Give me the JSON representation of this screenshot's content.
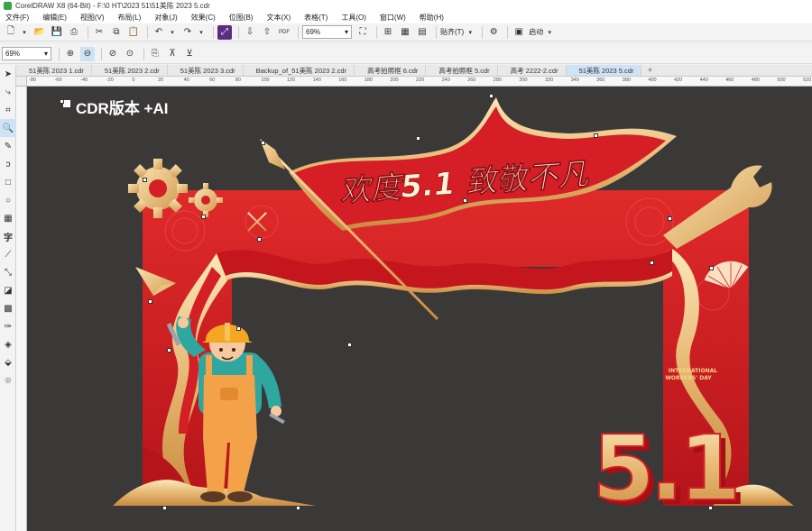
{
  "window": {
    "title": "CorelDRAW X8 (64-Bit) - F:\\0 HT\\2023 51\\51美陈 2023 5.cdr"
  },
  "menu": [
    "文件(F)",
    "编辑(E)",
    "视图(V)",
    "布局(L)",
    "对象(J)",
    "效果(C)",
    "位图(B)",
    "文本(X)",
    "表格(T)",
    "工具(O)",
    "窗口(W)",
    "帮助(H)"
  ],
  "toolbar": {
    "zoom_value": "69%",
    "snap_label": "贴齐(T)",
    "launch_label": "启动"
  },
  "toolbar2": {
    "zoom_value": "69%"
  },
  "tabs": [
    {
      "label": "51美陈 2023 1.cdr",
      "active": false
    },
    {
      "label": "51美陈 2023 2.cdr",
      "active": false
    },
    {
      "label": "51美陈 2023 3.cdr",
      "active": false
    },
    {
      "label": "Backup_of_51美陈 2023 2.cdr",
      "active": false
    },
    {
      "label": "高考拍照框 6.cdr",
      "active": false
    },
    {
      "label": "高考拍照框 5.cdr",
      "active": false
    },
    {
      "label": "高考 2222-2.cdr",
      "active": false
    },
    {
      "label": "51美陈 2023 5.cdr",
      "active": true
    }
  ],
  "ruler_ticks": [
    "-80",
    "-60",
    "-40",
    "-20",
    "0",
    "20",
    "40",
    "60",
    "80",
    "100",
    "120",
    "140",
    "160",
    "180",
    "200",
    "220",
    "240",
    "260",
    "280",
    "300",
    "320",
    "340",
    "360",
    "380",
    "400",
    "420",
    "440",
    "460",
    "480",
    "500",
    "520"
  ],
  "canvas": {
    "label": "CDR版本 +AI",
    "design": {
      "headline": "欢度5.1 致敬不凡",
      "big_number": "5.1",
      "subtitle_line1": "INTERNATIONAL",
      "subtitle_line2": "WORKERS' DAY"
    }
  }
}
